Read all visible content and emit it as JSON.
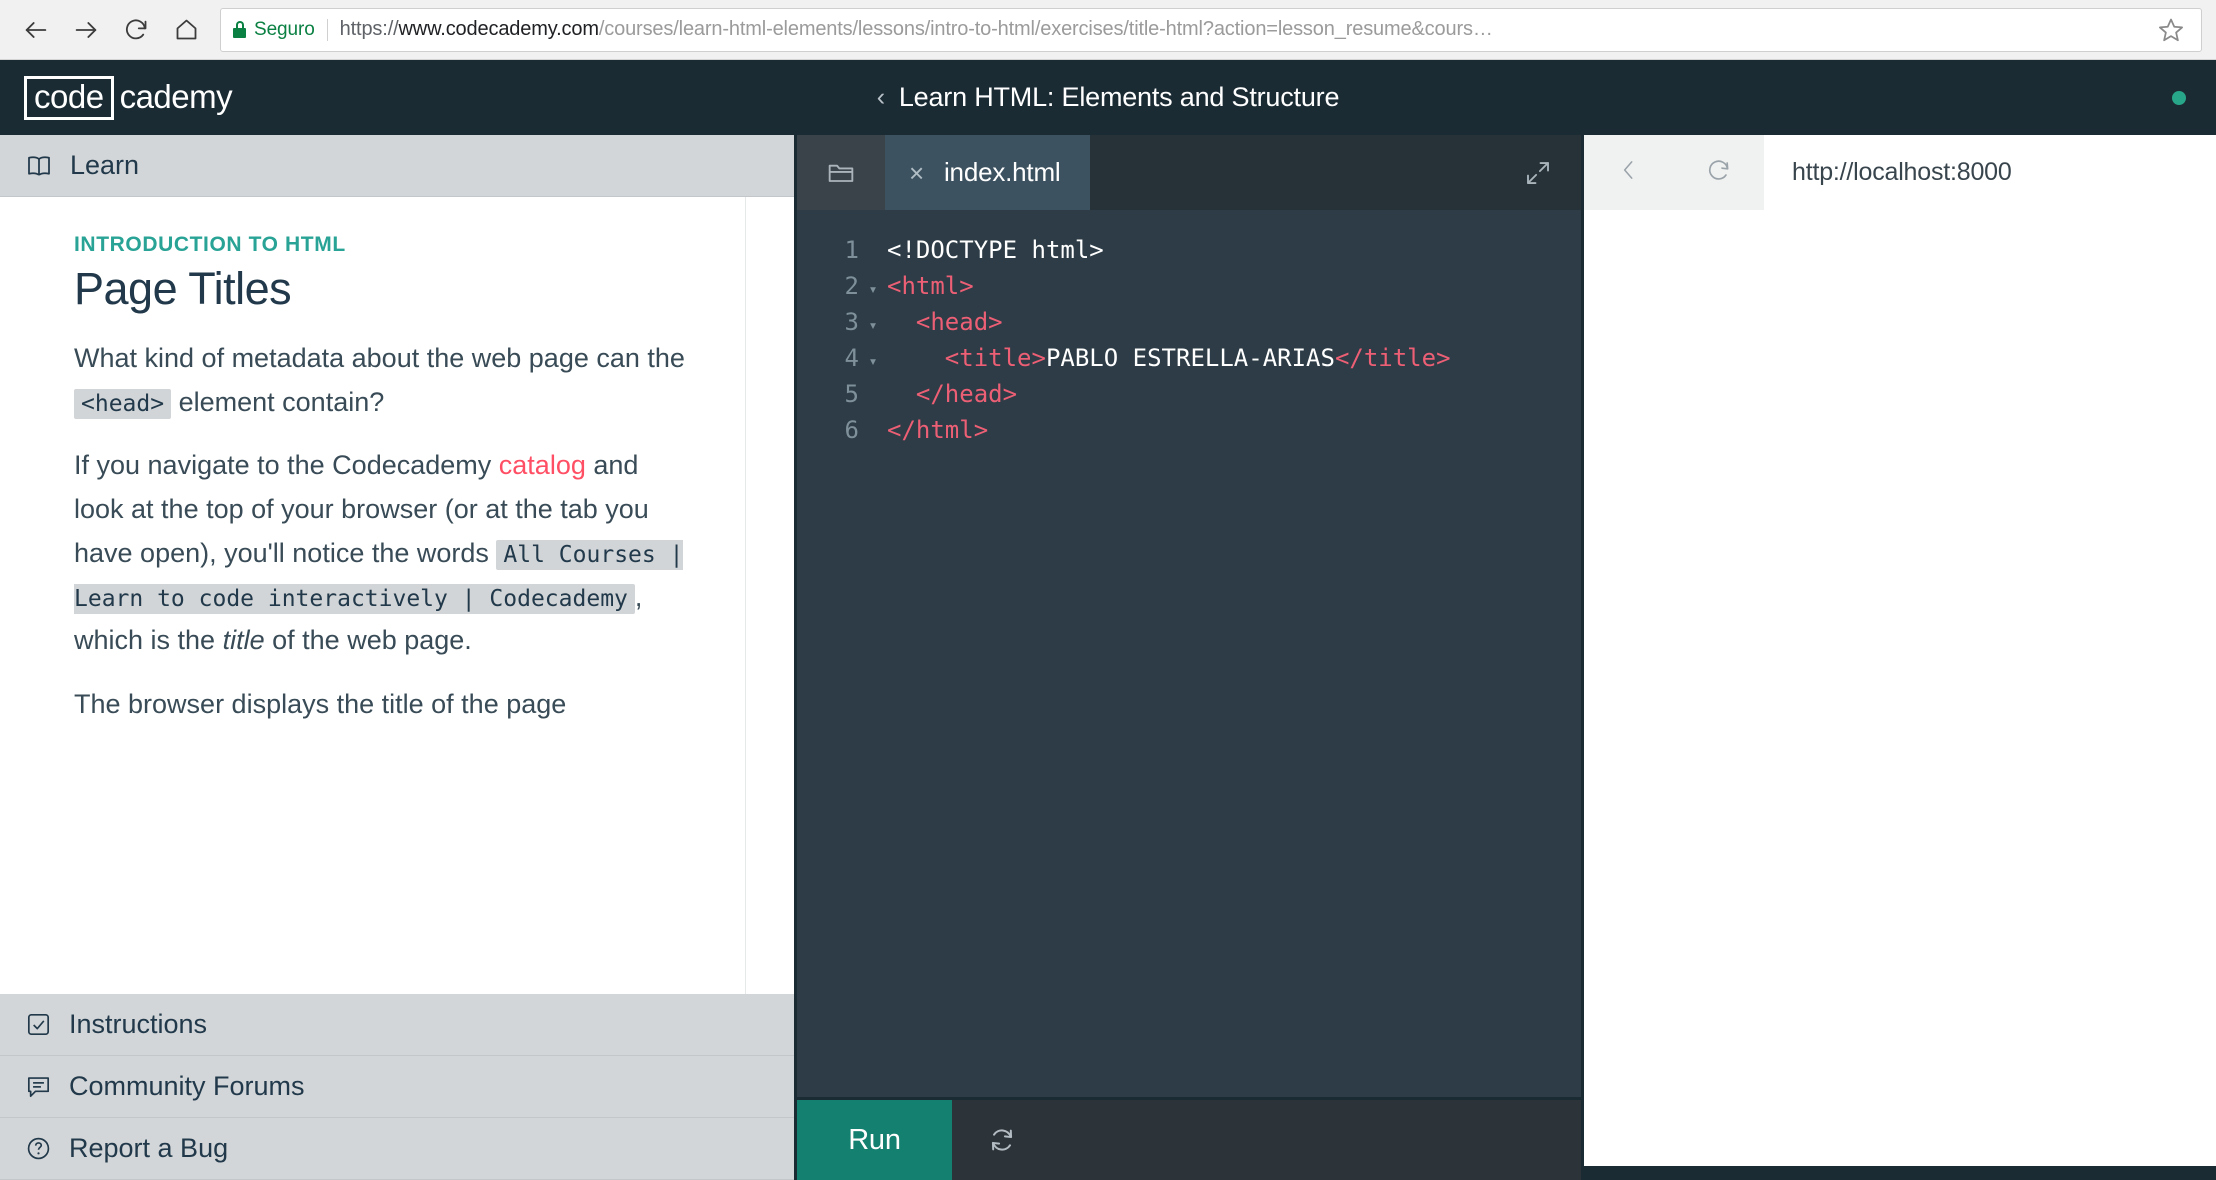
{
  "browser": {
    "back_icon": "arrow-left-icon",
    "forward_icon": "arrow-right-icon",
    "reload_icon": "reload-icon",
    "home_icon": "home-icon",
    "security_label": "Seguro",
    "lock_icon": "lock-icon",
    "url_scheme": "https://",
    "url_host": "www.codecademy.com",
    "url_path": "/courses/learn-html-elements/lessons/intro-to-html/exercises/title-html?action=lesson_resume&cours…",
    "url_full": "https://www.codecademy.com/courses/learn-html-elements/lessons/intro-to-html/exercises/title-html?action=lesson_resume&cours…",
    "bookmark_icon": "star-icon"
  },
  "header": {
    "logo_boxed": "code",
    "logo_rest": "cademy",
    "back_chevron": "‹",
    "course_title": "Learn HTML: Elements and Structure",
    "status_dot_color": "#28a68a"
  },
  "left_pane": {
    "learn_tab": {
      "label": "Learn",
      "icon": "book-icon"
    },
    "kicker": "INTRODUCTION TO HTML",
    "title": "Page Titles",
    "paragraph1": {
      "before": "What kind of metadata about the web page can the",
      "code": "<head>",
      "after": "element contain?"
    },
    "paragraph2": {
      "part1": "If you navigate to the Codecademy",
      "link": "catalog",
      "part2": "and look at the top of your browser (or at the tab you have open), you'll notice the words",
      "code": "All Courses | Learn to code interactively | Codecademy",
      "part3": ", which is the",
      "italic": "title",
      "part4": "of the web page."
    },
    "paragraph3": "The browser displays the title of the page",
    "accordions": [
      {
        "label": "Instructions",
        "icon": "checkbox-icon"
      },
      {
        "label": "Community Forums",
        "icon": "speech-bubble-icon"
      },
      {
        "label": "Report a Bug",
        "icon": "question-circle-icon"
      }
    ],
    "link_color": "#ff4f64",
    "kicker_color": "#29a395"
  },
  "editor": {
    "files_icon": "folder-icon",
    "tab": {
      "close_icon": "close-icon",
      "filename": "index.html"
    },
    "expand_icon": "expand-icon",
    "lines": [
      {
        "num": "1",
        "fold": "",
        "indent": "",
        "tokens": [
          {
            "t": "<!DOCTYPE html>",
            "c": "plain"
          }
        ]
      },
      {
        "num": "2",
        "fold": "▾",
        "indent": "",
        "tokens": [
          {
            "t": "<html>",
            "c": "tag"
          }
        ]
      },
      {
        "num": "3",
        "fold": "▾",
        "indent": "  ",
        "tokens": [
          {
            "t": "<head>",
            "c": "tag"
          }
        ]
      },
      {
        "num": "4",
        "fold": "▾",
        "indent": "    ",
        "tokens": [
          {
            "t": "<title>",
            "c": "tag"
          },
          {
            "t": "PABLO ESTRELLA-ARIAS",
            "c": "plain"
          },
          {
            "t": "</title>",
            "c": "tag"
          }
        ]
      },
      {
        "num": "5",
        "fold": "",
        "indent": "  ",
        "tokens": [
          {
            "t": "</head>",
            "c": "tag"
          }
        ]
      },
      {
        "num": "6",
        "fold": "",
        "indent": "",
        "tokens": [
          {
            "t": "</html>",
            "c": "tag"
          }
        ]
      }
    ],
    "run_label": "Run",
    "run_color": "#14806f",
    "reset_icon": "refresh-icon"
  },
  "preview": {
    "back_icon": "chevron-left-icon",
    "reload_icon": "reload-icon",
    "url": "http://localhost:8000",
    "content": ""
  }
}
